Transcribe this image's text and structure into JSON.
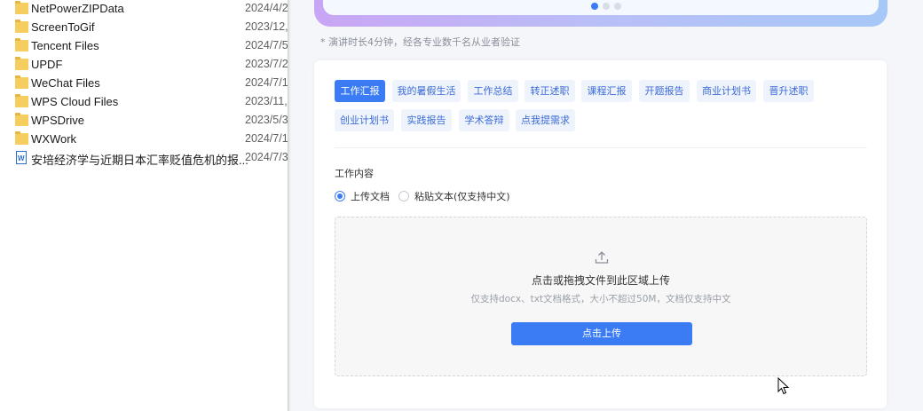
{
  "explorer": {
    "files": [
      {
        "name": "NetPowerZIPData",
        "date": "2024/4/2",
        "type": "folder"
      },
      {
        "name": "ScreenToGif",
        "date": "2023/12,",
        "type": "folder"
      },
      {
        "name": "Tencent Files",
        "date": "2024/7/5",
        "type": "folder"
      },
      {
        "name": "UPDF",
        "date": "2023/7/2",
        "type": "folder"
      },
      {
        "name": "WeChat Files",
        "date": "2024/7/1",
        "type": "folder"
      },
      {
        "name": "WPS Cloud Files",
        "date": "2023/11,",
        "type": "folder"
      },
      {
        "name": "WPSDrive",
        "date": "2023/5/3",
        "type": "folder"
      },
      {
        "name": "WXWork",
        "date": "2024/7/1",
        "type": "folder"
      },
      {
        "name": "安培经济学与近期日本汇率贬值危机的报...",
        "date": "2024/7/3",
        "type": "word-doc",
        "icon_letter": "W"
      }
    ]
  },
  "banner": {
    "footnote": "* 演讲时长4分钟，经各专业数千名从业者验证",
    "slide_count": 3,
    "active_slide": 1
  },
  "form": {
    "tags": [
      {
        "label": "工作汇报",
        "active": true
      },
      {
        "label": "我的暑假生活",
        "active": false
      },
      {
        "label": "工作总结",
        "active": false
      },
      {
        "label": "转正述职",
        "active": false
      },
      {
        "label": "课程汇报",
        "active": false
      },
      {
        "label": "开题报告",
        "active": false
      },
      {
        "label": "商业计划书",
        "active": false
      },
      {
        "label": "晋升述职",
        "active": false
      },
      {
        "label": "创业计划书",
        "active": false
      },
      {
        "label": "实践报告",
        "active": false
      },
      {
        "label": "学术答辩",
        "active": false
      },
      {
        "label": "点我提需求",
        "active": false
      }
    ],
    "section_label": "工作内容",
    "radio_upload": "上传文档",
    "radio_paste": "粘贴文本(仅支持中文)",
    "selected_mode": "upload",
    "dropzone_title": "点击或拖拽文件到此区域上传",
    "dropzone_hint": "仅支持docx、txt文档格式，大小不超过50M，文档仅支持中文",
    "upload_button": "点击上传"
  },
  "colors": {
    "accent": "#3b7cf5",
    "tag_bg": "#eef3fc",
    "tag_text": "#3b6bd6",
    "folder": "#f6cd5f"
  }
}
